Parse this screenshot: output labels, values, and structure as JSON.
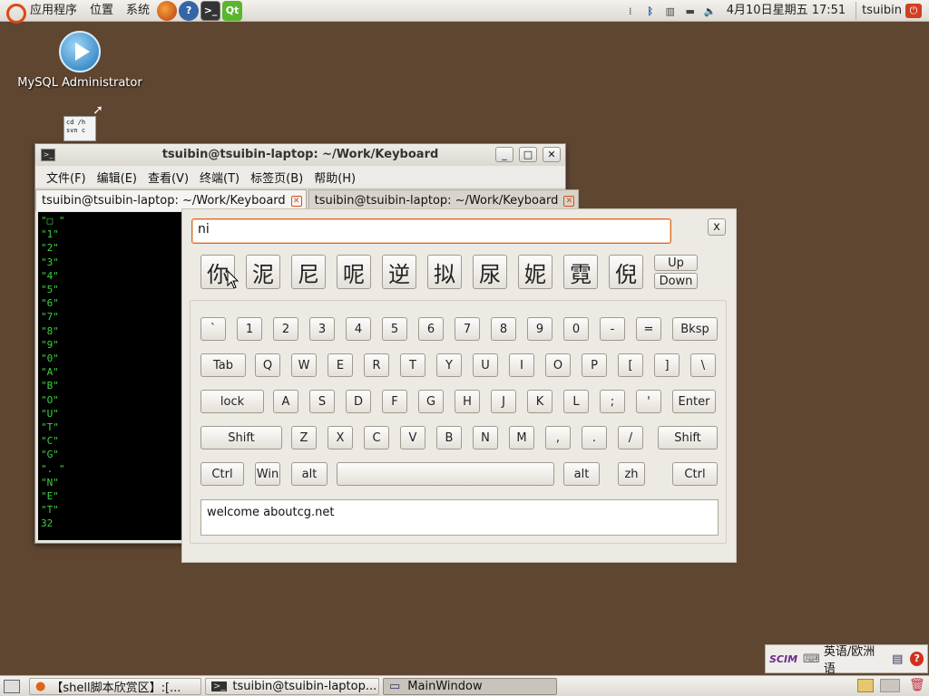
{
  "top_panel": {
    "menus": [
      "应用程序",
      "位置",
      "系统"
    ],
    "datetime": "4月10日星期五 17:51",
    "user": "tsuibin"
  },
  "desktop": {
    "mysql_icon_label": "MySQL Administrator",
    "script_icon_text": [
      "cd /h",
      "svn c"
    ]
  },
  "terminal": {
    "title": "tsuibin@tsuibin-laptop: ~/Work/Keyboard",
    "menus": [
      "文件(F)",
      "编辑(E)",
      "查看(V)",
      "终端(T)",
      "标签页(B)",
      "帮助(H)"
    ],
    "tabs": [
      "tsuibin@tsuibin-laptop: ~/Work/Keyboard",
      "tsuibin@tsuibin-laptop: ~/Work/Keyboard"
    ],
    "lines": [
      "\"□ \"",
      "\"1\"",
      "\"2\"",
      "\"3\"",
      "\"4\"",
      "\"5\"",
      "\"6\"",
      "\"7\"",
      "\"8\"",
      "\"9\"",
      "\"0\"",
      "\"A\"",
      "\"B\"",
      "\"O\"",
      "\"U\"",
      "\"T\"",
      "\"C\"",
      "\"G\"",
      "\". \"",
      "\"N\"",
      "\"E\"",
      "\"T\"",
      "32"
    ]
  },
  "keyboard": {
    "input_value": "ni",
    "close_label": "x",
    "candidates": [
      "你",
      "泥",
      "尼",
      "呢",
      "逆",
      "拟",
      "尿",
      "妮",
      "霓",
      "倪"
    ],
    "up_label": "Up",
    "down_label": "Down",
    "rows": [
      [
        "`",
        "1",
        "2",
        "3",
        "4",
        "5",
        "6",
        "7",
        "8",
        "9",
        "0",
        "-",
        "=",
        "Bksp"
      ],
      [
        "Tab",
        "Q",
        "W",
        "E",
        "R",
        "T",
        "Y",
        "U",
        "I",
        "O",
        "P",
        "[",
        "]",
        "\\"
      ],
      [
        "lock",
        "A",
        "S",
        "D",
        "F",
        "G",
        "H",
        "J",
        "K",
        "L",
        ";",
        "'",
        "Enter"
      ],
      [
        "Shift",
        "Z",
        "X",
        "C",
        "V",
        "B",
        "N",
        "M",
        ",",
        ".",
        "/",
        "Shift"
      ],
      [
        "Ctrl",
        "Win",
        "alt",
        "",
        "alt",
        "zh",
        "Ctrl"
      ]
    ],
    "output_text": "welcome aboutcg.net"
  },
  "taskbar": {
    "items": [
      "【shell脚本欣赏区】:[...",
      "tsuibin@tsuibin-laptop...",
      "MainWindow"
    ]
  },
  "ime_bar": {
    "mode": "英语/欧洲语"
  }
}
